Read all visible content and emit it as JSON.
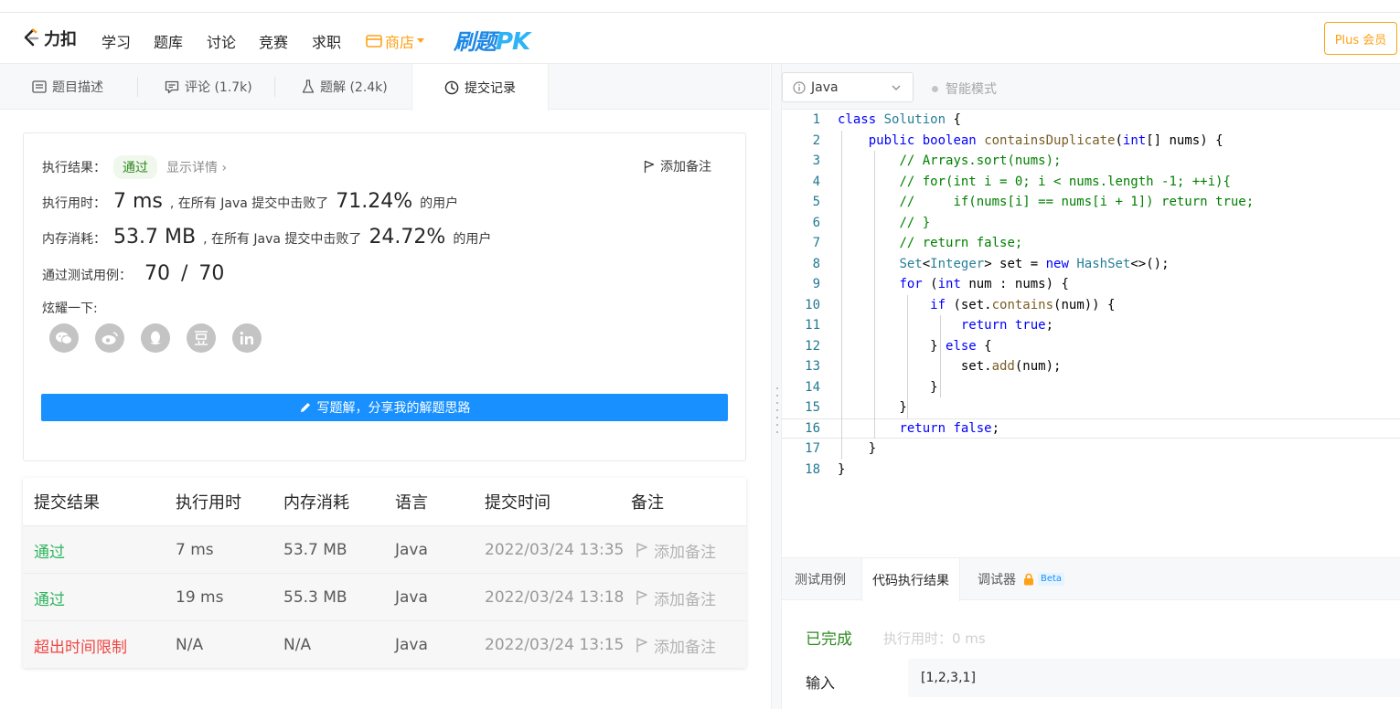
{
  "nav": {
    "logo_text": "力扣",
    "items": [
      "学习",
      "题库",
      "讨论",
      "竞赛",
      "求职"
    ],
    "shop": "商店",
    "pk_main": "刷题",
    "pk_suffix": "PK",
    "plus": "Plus 会员"
  },
  "tabs": [
    {
      "label": "题目描述",
      "icon": "description-icon"
    },
    {
      "label": "评论 (1.7k)",
      "icon": "comment-icon"
    },
    {
      "label": "题解 (2.4k)",
      "icon": "flask-icon"
    },
    {
      "label": "提交记录",
      "icon": "clock-icon"
    }
  ],
  "result": {
    "label_status": "执行结果：",
    "status": "通过",
    "details": "显示详情 ›",
    "add_note": "添加备注",
    "label_time": "执行用时：",
    "time": "7 ms",
    "beat_text": ", 在所有 Java 提交中击败了",
    "time_pct": "71.24%",
    "users": "的用户",
    "label_mem": "内存消耗：",
    "mem": "53.7 MB",
    "mem_pct": "24.72%",
    "label_cases": "通过测试用例：",
    "cases_passed": "70",
    "cases_sep": "/",
    "cases_total": "70",
    "label_share": "炫耀一下:",
    "write_btn": "写题解，分享我的解题思路"
  },
  "share_icons": [
    {
      "name": "wechat-icon",
      "glyph": "微"
    },
    {
      "name": "weibo-icon",
      "glyph": "博"
    },
    {
      "name": "qq-icon",
      "glyph": "Q"
    },
    {
      "name": "douban-icon",
      "glyph": "豆"
    },
    {
      "name": "linkedin-icon",
      "glyph": "in"
    }
  ],
  "table": {
    "headers": [
      "提交结果",
      "执行用时",
      "内存消耗",
      "语言",
      "提交时间",
      "备注"
    ],
    "rows": [
      {
        "status": "通过",
        "kind": "ok",
        "time": "7 ms",
        "mem": "53.7 MB",
        "lang": "Java",
        "submitted": "2022/03/24 13:35",
        "note": "添加备注"
      },
      {
        "status": "通过",
        "kind": "ok",
        "time": "19 ms",
        "mem": "55.3 MB",
        "lang": "Java",
        "submitted": "2022/03/24 13:18",
        "note": "添加备注"
      },
      {
        "status": "超出时间限制",
        "kind": "tle",
        "time": "N/A",
        "mem": "N/A",
        "lang": "Java",
        "submitted": "2022/03/24 13:15",
        "note": "添加备注"
      }
    ]
  },
  "editor": {
    "language": "Java",
    "smart_mode": "智能模式",
    "lines": [
      "class Solution {",
      "    public boolean containsDuplicate(int[] nums) {",
      "        // Arrays.sort(nums);",
      "        // for(int i = 0; i < nums.length -1; ++i){",
      "        //     if(nums[i] == nums[i + 1]) return true;",
      "        // }",
      "        // return false;",
      "        Set<Integer> set = new HashSet<>();",
      "        for (int num : nums) {",
      "            if (set.contains(num)) {",
      "                return true;",
      "            } else {",
      "                set.add(num);",
      "            }",
      "        }",
      "        return false;",
      "    }",
      "}"
    ],
    "current_line": 16
  },
  "bottom": {
    "tabs": [
      "测试用例",
      "代码执行结果",
      "调试器"
    ],
    "beta": "Beta",
    "done": "已完成",
    "exec": "执行用时：0 ms",
    "input_label": "输入",
    "input_value": "[1,2,3,1]"
  }
}
